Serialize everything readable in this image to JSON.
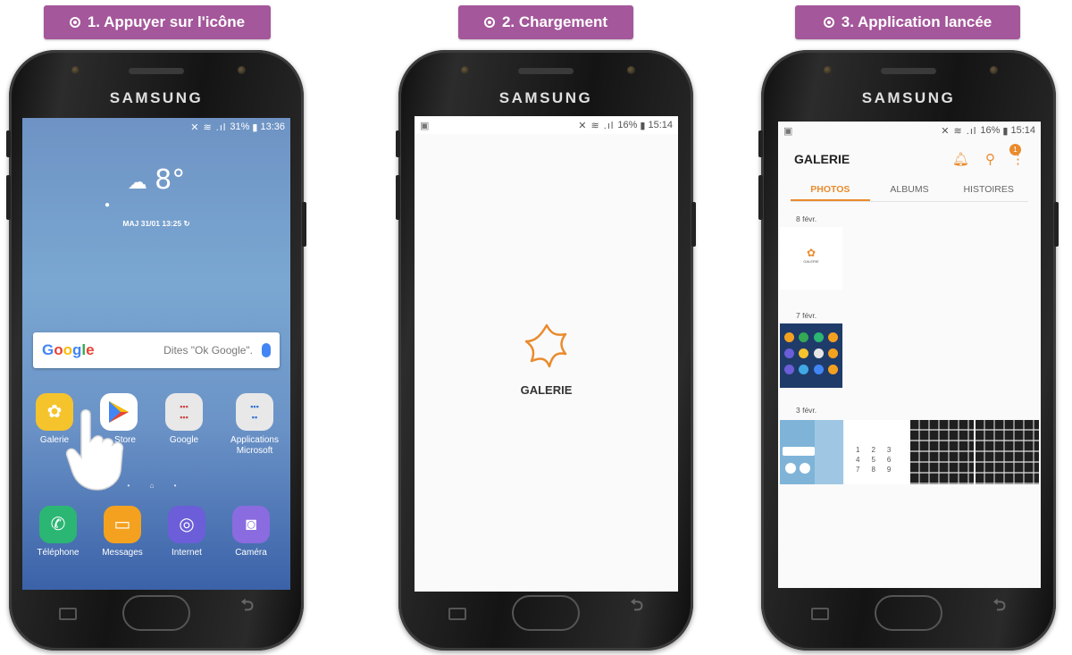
{
  "steps": [
    {
      "label": "1. Appuyer sur l'icône"
    },
    {
      "label": "2. Chargement"
    },
    {
      "label": "3. Application lancée"
    }
  ],
  "device": {
    "brand": "SAMSUNG"
  },
  "screen1": {
    "status": {
      "battery": "31%",
      "time": "13:36"
    },
    "weather": {
      "temp": "8°",
      "updated": "MAJ 31/01 13:25"
    },
    "search": {
      "logo_parts": [
        "G",
        "o",
        "o",
        "g",
        "l",
        "e"
      ],
      "hint": "Dites \"Ok Google\"."
    },
    "apps": [
      {
        "name": "Galerie",
        "icon": "flower-icon",
        "color": "#f5c32c"
      },
      {
        "name": "Play Store",
        "icon": "play-icon",
        "color": "#ffffff"
      },
      {
        "name": "Google",
        "icon": "google-folder-icon",
        "color": "#e6e6e6"
      },
      {
        "name": "Applications Microsoft",
        "icon": "microsoft-folder-icon",
        "color": "#e6e6e6"
      }
    ],
    "visible_app_label_1": "Galerie",
    "visible_app_label_2": "Store",
    "dock": [
      {
        "name": "Téléphone",
        "icon": "phone-icon",
        "color": "#2bb673"
      },
      {
        "name": "Messages",
        "icon": "messages-icon",
        "color": "#f4a11f"
      },
      {
        "name": "Internet",
        "icon": "internet-icon",
        "color": "#6b5ed8"
      },
      {
        "name": "Caméra",
        "icon": "camera-icon",
        "color": "#8a6be0"
      }
    ]
  },
  "screen2": {
    "status": {
      "battery": "16%",
      "time": "15:14"
    },
    "splash_label": "GALERIE"
  },
  "screen3": {
    "status": {
      "battery": "16%",
      "time": "15:14"
    },
    "title": "GALERIE",
    "notification_count": "1",
    "tabs": [
      {
        "label": "PHOTOS",
        "active": true
      },
      {
        "label": "ALBUMS",
        "active": false
      },
      {
        "label": "HISTOIRES",
        "active": false
      }
    ],
    "sections": [
      {
        "date": "8 févr."
      },
      {
        "date": "7 févr."
      },
      {
        "date": "3 févr."
      }
    ],
    "thumb_label": "GALERIE"
  },
  "colors": {
    "step_bg": "#a4579a",
    "accent": "#ea8b2d"
  }
}
